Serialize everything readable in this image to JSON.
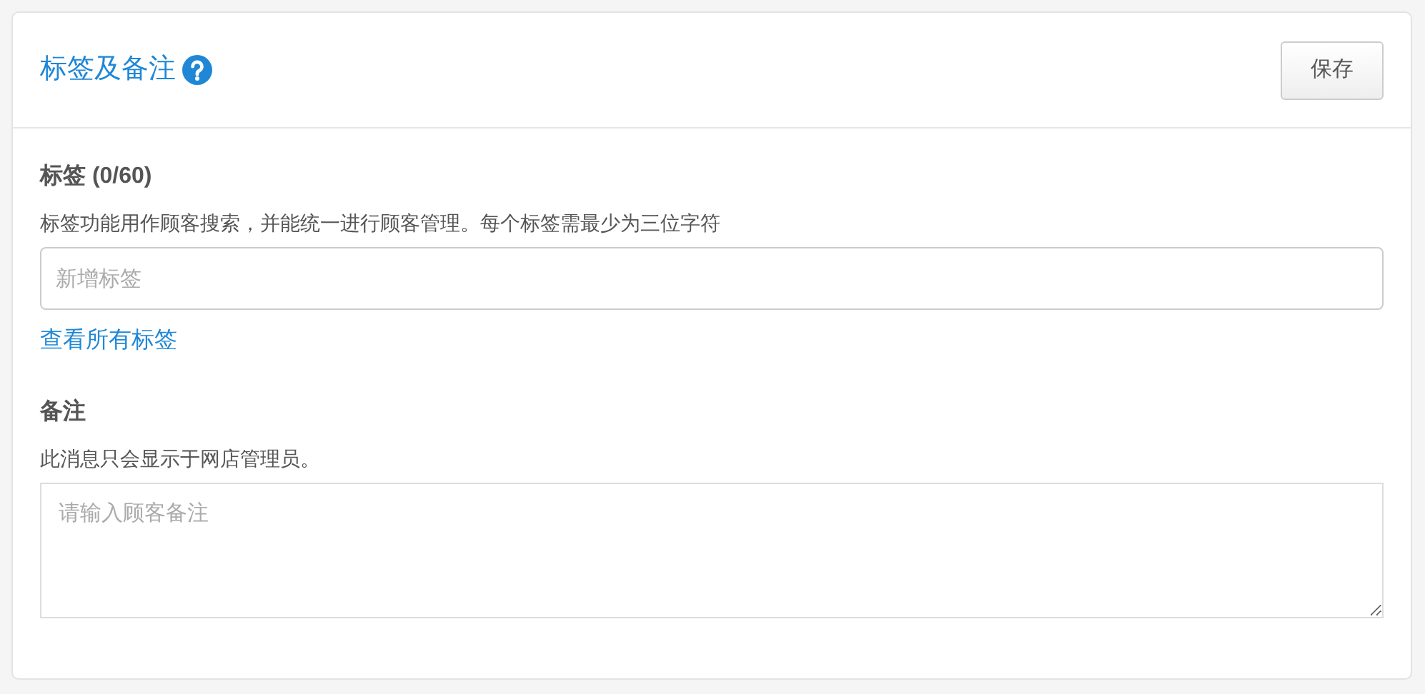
{
  "panel": {
    "title": "标签及备注",
    "save_button": "保存"
  },
  "tags": {
    "label": "标签 (0/60)",
    "hint": "标签功能用作顾客搜索，并能统一进行顾客管理。每个标签需最少为三位字符",
    "placeholder": "新增标签",
    "link": "查看所有标签"
  },
  "notes": {
    "label": "备注",
    "hint": "此消息只会显示于网店管理员。",
    "placeholder": "请输入顾客备注"
  }
}
